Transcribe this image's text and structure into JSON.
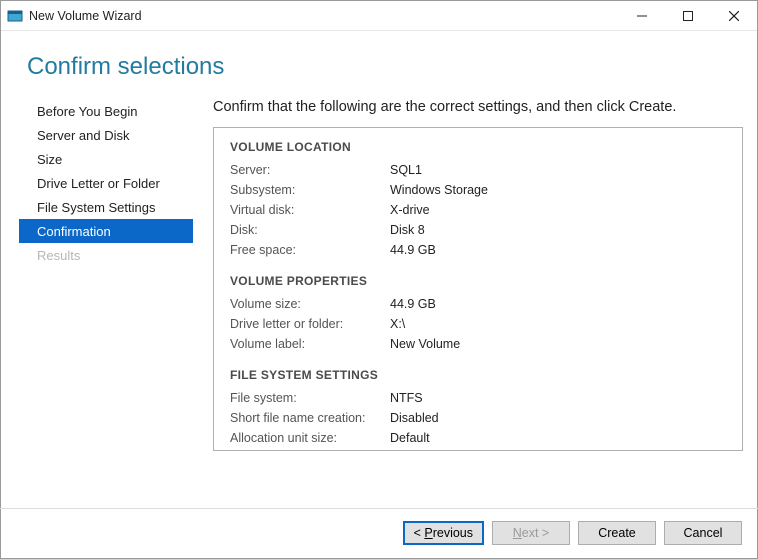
{
  "window": {
    "title": "New Volume Wizard"
  },
  "heading": "Confirm selections",
  "sidebar": {
    "items": [
      {
        "label": "Before You Begin"
      },
      {
        "label": "Server and Disk"
      },
      {
        "label": "Size"
      },
      {
        "label": "Drive Letter or Folder"
      },
      {
        "label": "File System Settings"
      },
      {
        "label": "Confirmation"
      },
      {
        "label": "Results"
      }
    ]
  },
  "main": {
    "instruction": "Confirm that the following are the correct settings, and then click Create.",
    "sections": {
      "location": {
        "header": "VOLUME LOCATION",
        "server_label": "Server:",
        "server_value": "SQL1",
        "subsystem_label": "Subsystem:",
        "subsystem_value": "Windows Storage",
        "vdisk_label": "Virtual disk:",
        "vdisk_value": "X-drive",
        "disk_label": "Disk:",
        "disk_value": "Disk 8",
        "free_label": "Free space:",
        "free_value": "44.9 GB"
      },
      "properties": {
        "header": "VOLUME PROPERTIES",
        "size_label": "Volume size:",
        "size_value": "44.9 GB",
        "drive_label": "Drive letter or folder:",
        "drive_value": "X:\\",
        "label_label": "Volume label:",
        "label_value": "New Volume"
      },
      "filesystem": {
        "header": "FILE SYSTEM SETTINGS",
        "fs_label": "File system:",
        "fs_value": "NTFS",
        "sfn_label": "Short file name creation:",
        "sfn_value": "Disabled",
        "au_label": "Allocation unit size:",
        "au_value": "Default"
      }
    }
  },
  "buttons": {
    "previous_pre": "< ",
    "previous_u": "P",
    "previous_post": "revious",
    "next_u": "N",
    "next_post": "ext >",
    "create": "Create",
    "cancel": "Cancel"
  }
}
